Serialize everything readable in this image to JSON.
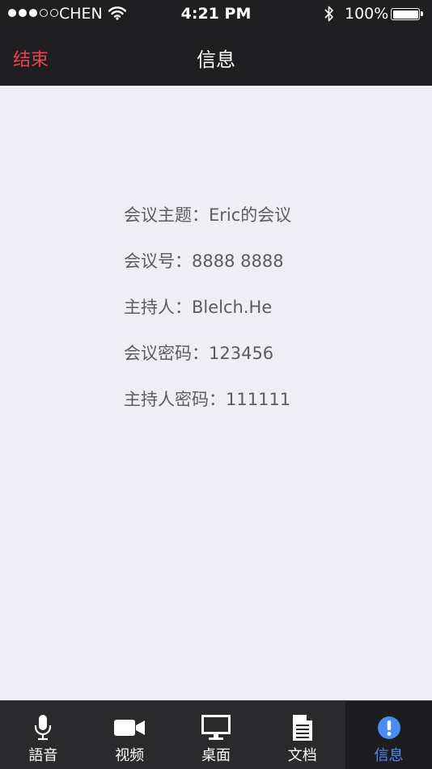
{
  "status_bar": {
    "carrier": "CHEN",
    "time": "4:21 PM",
    "battery": "100%",
    "battery_level": 1.0
  },
  "nav": {
    "end_label": "结束",
    "title": "信息"
  },
  "meeting": {
    "rows": [
      {
        "label": "会议主题：",
        "value": "Eric的会议"
      },
      {
        "label": "会议号：",
        "value": "8888 8888"
      },
      {
        "label": "主持人：",
        "value": "Blelch.He"
      },
      {
        "label": "会议密码：",
        "value": "123456"
      },
      {
        "label": "主持人密码：",
        "value": "111111"
      }
    ]
  },
  "tabs": [
    {
      "label": "語音",
      "icon": "microphone-icon"
    },
    {
      "label": "视频",
      "icon": "video-camera-icon"
    },
    {
      "label": "桌面",
      "icon": "monitor-icon"
    },
    {
      "label": "文档",
      "icon": "document-icon"
    },
    {
      "label": "信息",
      "icon": "info-icon",
      "active": true
    }
  ],
  "colors": {
    "accent": "#4a8df2",
    "end_red": "#e8414a",
    "bar_bg": "#1f1f21",
    "tab_bg": "#2a2a2c",
    "content_bg": "#efeef4"
  }
}
